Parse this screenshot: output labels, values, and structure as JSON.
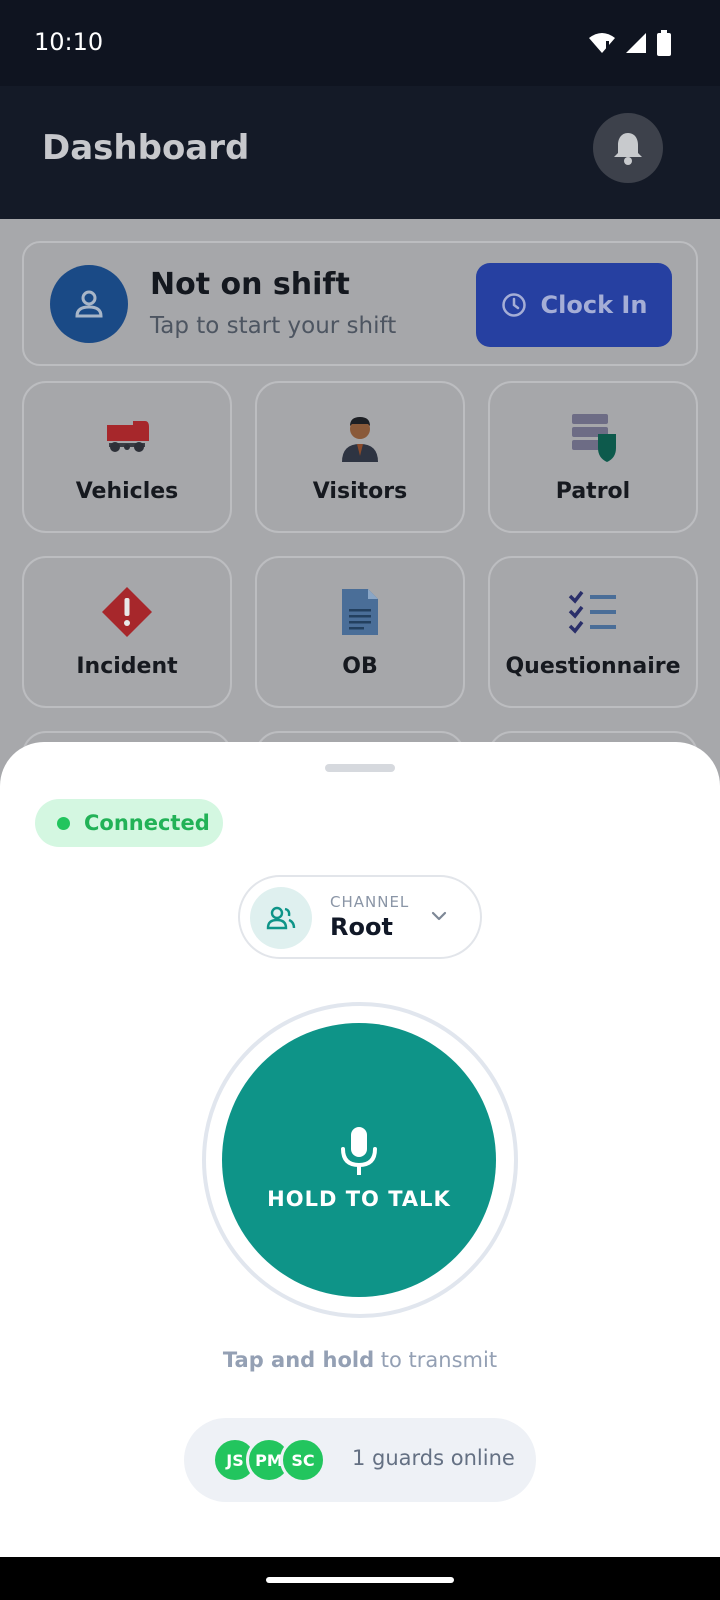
{
  "status_bar": {
    "time": "10:10",
    "icons": [
      "wifi-icon",
      "signal-icon",
      "battery-icon"
    ]
  },
  "header": {
    "title": "Dashboard",
    "bell_icon": "bell-icon"
  },
  "shift": {
    "title": "Not on shift",
    "subtitle": "Tap to start your shift",
    "clock_in_label": "Clock In"
  },
  "tiles": [
    {
      "label": "Vehicles",
      "icon": "vehicle-icon"
    },
    {
      "label": "Visitors",
      "icon": "visitor-icon"
    },
    {
      "label": "Patrol",
      "icon": "patrol-icon"
    },
    {
      "label": "Incident",
      "icon": "incident-icon"
    },
    {
      "label": "OB",
      "icon": "document-icon"
    },
    {
      "label": "Questionnaire",
      "icon": "checklist-icon"
    }
  ],
  "sheet": {
    "connection_status": "Connected",
    "channel": {
      "caption": "CHANNEL",
      "name": "Root"
    },
    "ptt_label": "HOLD TO TALK",
    "hint_strong": "Tap and hold",
    "hint_rest": " to transmit",
    "avatars": [
      "JS",
      "PM",
      "SC"
    ],
    "online_text": "1 guards online"
  },
  "colors": {
    "accent_teal": "#0e9488",
    "connected_green": "#22c55e",
    "clock_in_blue": "#2640a1"
  }
}
